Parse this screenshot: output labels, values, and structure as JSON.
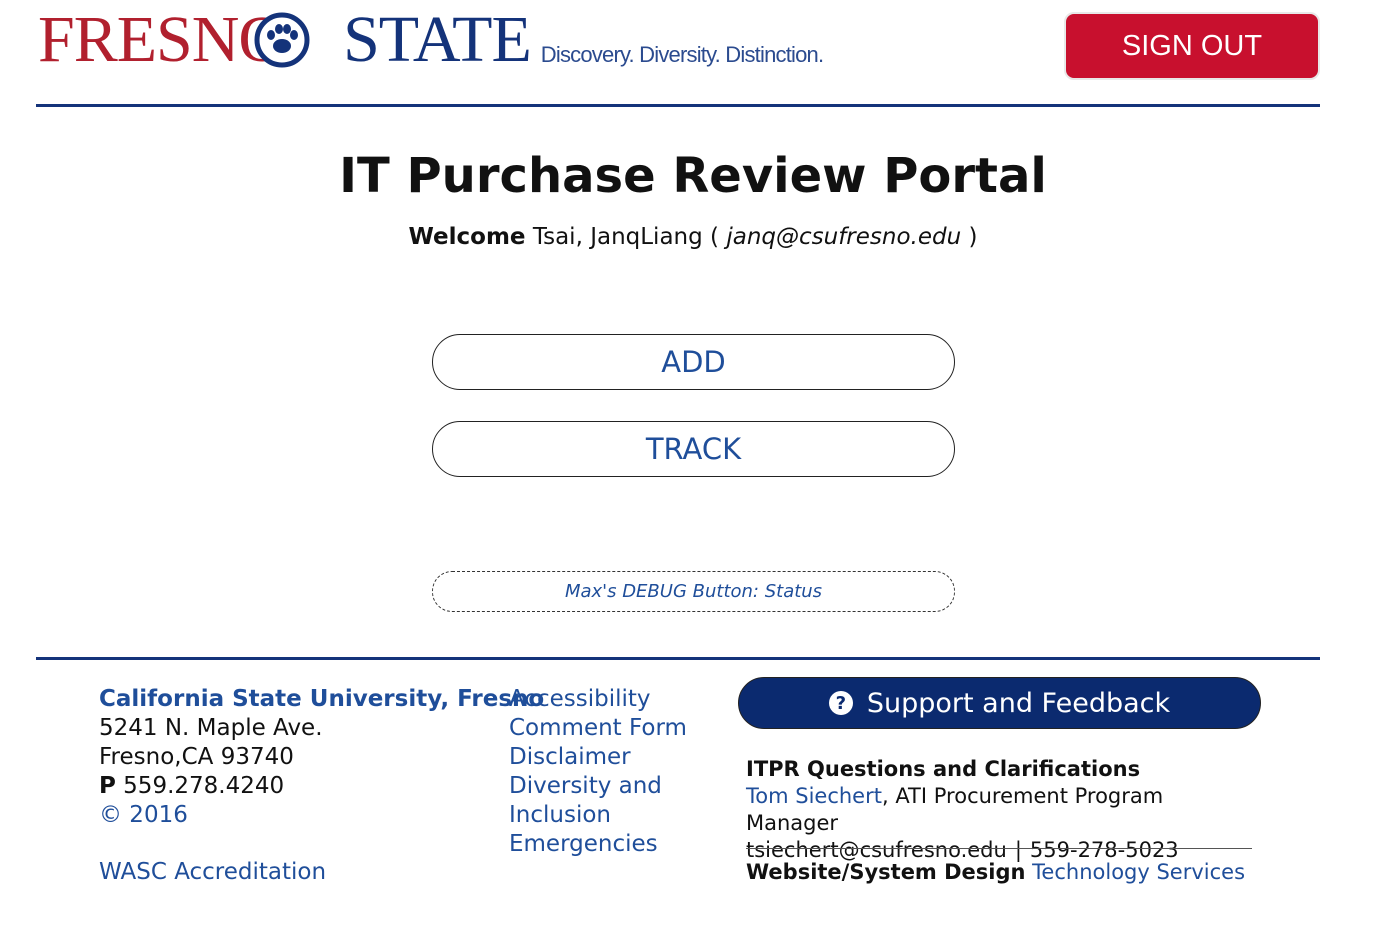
{
  "header": {
    "logo_part1": "FRESNO",
    "logo_part2": "STATE",
    "tagline": "Discovery. Diversity. Distinction.",
    "signout_label": "SIGN OUT"
  },
  "main": {
    "title": "IT Purchase Review Portal",
    "welcome_label": "Welcome",
    "user_name": "Tsai, JanqLiang",
    "open_paren": "(",
    "user_email": "janq@csufresno.edu",
    "close_paren": ")",
    "add_label": "ADD",
    "track_label": "TRACK",
    "debug_label": "Max's DEBUG Button: Status"
  },
  "footer": {
    "university": "California State University, Fresno",
    "address1": "5241 N. Maple Ave.",
    "address2": "Fresno,CA 93740",
    "phone_prefix": "P",
    "phone": "559.278.4240",
    "copyright": "© 2016",
    "wasc": "WASC Accreditation",
    "links": [
      "Accessibility",
      "Comment Form",
      "Disclaimer",
      "Diversity and Inclusion",
      "Emergencies"
    ],
    "support_label": "Support and Feedback",
    "support_icon": "?",
    "itpr_heading": "ITPR Questions and Clarifications",
    "contact_name": "Tom Siechert",
    "contact_title": ", ATI Procurement Program Manager",
    "contact_email": "tsiechert@csufresno.edu",
    "contact_sep": "|",
    "contact_phone": "559-278-5023",
    "design_label": "Website/System Design",
    "design_link": "Technology Services"
  },
  "colors": {
    "brand_red": "#c8102e",
    "brand_blue": "#14337a",
    "link_blue": "#1f4e9a",
    "support_bg": "#0b2a6f"
  }
}
